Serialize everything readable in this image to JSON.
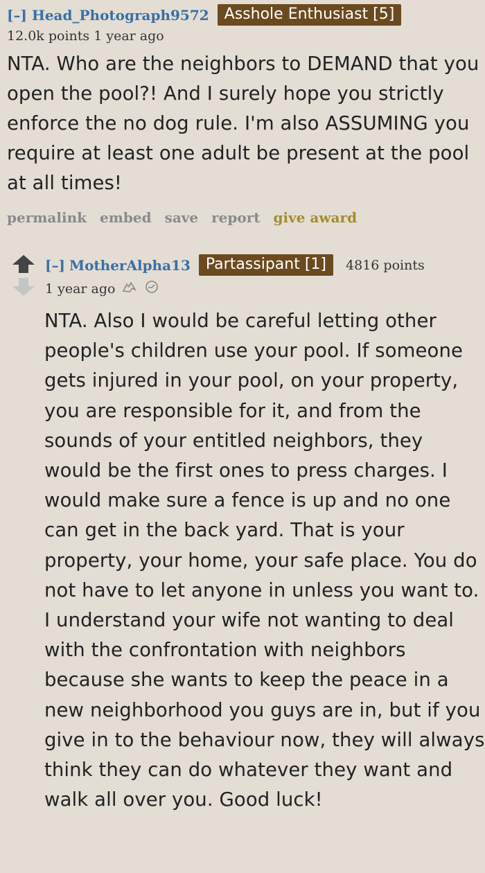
{
  "comment1": {
    "toggle": "[–]",
    "author": "Head_Photograph9572",
    "flair": "Asshole Enthusiast [5]",
    "points": "12.0k points",
    "age": "1 year ago",
    "body": "NTA. Who are the neighbors to DEMAND that you open the pool?! And I surely hope you strictly enforce the no dog rule. I'm also ASSUMING you require at least one adult be present at the pool at all times!",
    "actions": {
      "permalink": "permalink",
      "embed": "embed",
      "save": "save",
      "report": "report",
      "give_award": "give award"
    }
  },
  "comment2": {
    "toggle": "[–]",
    "author": "MotherAlpha13",
    "flair": "Partassipant [1]",
    "points": "4816 points",
    "age": "1 year ago",
    "icons": [
      "award-silver-icon",
      "clock-icon"
    ],
    "body": "NTA. Also I would be careful letting other people's children use your pool. If someone gets injured in your pool, on your property, you are responsible for it, and from the sounds of your entitled neighbors, they would be the first ones to press charges. I would make sure a fence is up and no one can get in the back yard. That is your property, your home, your safe place. You do not have to let anyone in unless you want to. I understand your wife not wanting to deal with the confrontation with neighbors because she wants to keep the peace in a new neighborhood you guys are in, but if you give in to the behaviour now, they will always think they can do whatever they want and walk all over you. Good luck!"
  },
  "colors": {
    "background": "#e3ddd3",
    "flair_bg": "#6b4a1f",
    "author_link": "#3a6fa5",
    "award_link": "#a58b2f"
  }
}
